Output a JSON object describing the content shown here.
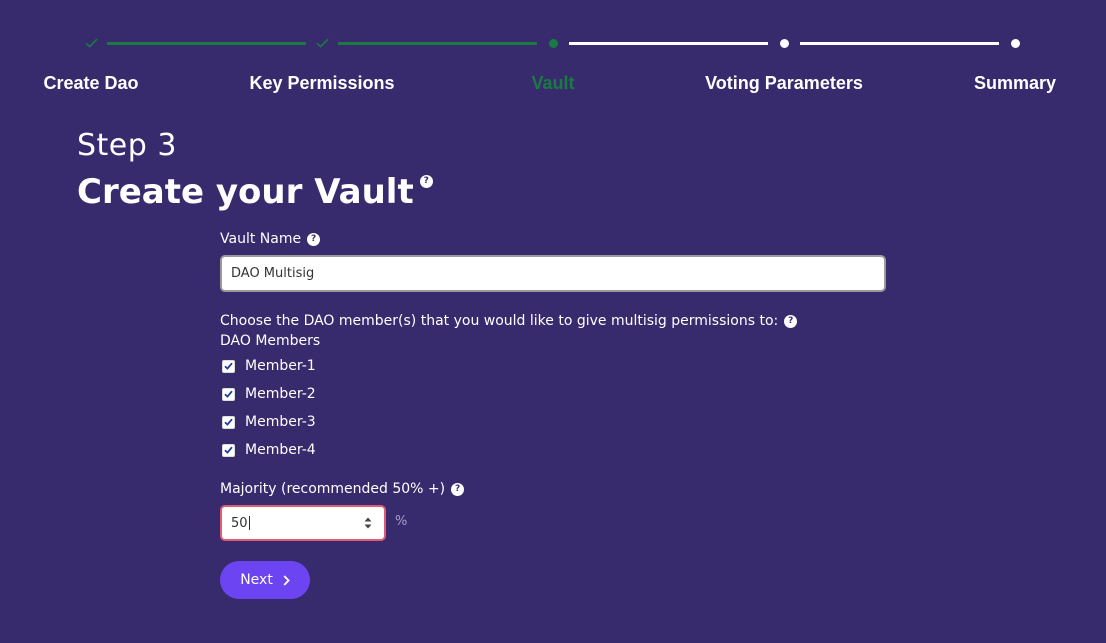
{
  "stepper": {
    "steps": [
      {
        "label": "Create Dao",
        "status": "complete",
        "icon": "check-icon"
      },
      {
        "label": "Key Permissions",
        "status": "complete",
        "icon": "check-icon"
      },
      {
        "label": "Vault",
        "status": "current",
        "icon": "dot-icon"
      },
      {
        "label": "Voting Parameters",
        "status": "upcoming",
        "icon": "dot-icon"
      },
      {
        "label": "Summary",
        "status": "upcoming",
        "icon": "dot-icon"
      }
    ]
  },
  "header": {
    "step_number": "Step 3",
    "title": "Create your Vault",
    "help_icon": "?"
  },
  "form": {
    "vault_name": {
      "label": "Vault Name",
      "value": "DAO Multisig",
      "help_icon": "?"
    },
    "members": {
      "prompt": "Choose the DAO member(s) that you would like to give multisig permissions to:",
      "help_icon": "?",
      "group_label": "DAO Members",
      "items": [
        {
          "label": "Member-1",
          "checked": true
        },
        {
          "label": "Member-2",
          "checked": true
        },
        {
          "label": "Member-3",
          "checked": true
        },
        {
          "label": "Member-4",
          "checked": true
        }
      ]
    },
    "majority": {
      "label": "Majority (recommended 50% +)",
      "value": "50",
      "unit": "%",
      "help_icon": "?"
    },
    "next_label": "Next"
  },
  "colors": {
    "background": "#372b6e",
    "complete": "#1a7a42",
    "accent": "#6d44f2",
    "error_border": "#e05a73"
  }
}
